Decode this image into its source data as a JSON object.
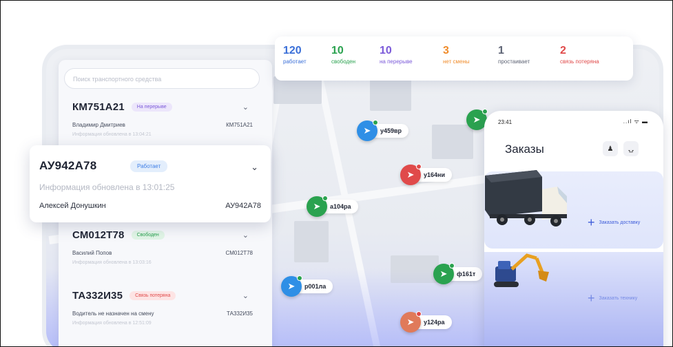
{
  "stats": [
    {
      "value": "120",
      "label": "работает",
      "color": "#3a6fd8"
    },
    {
      "value": "10",
      "label": "свободен",
      "color": "#2aa24f"
    },
    {
      "value": "10",
      "label": "на перерыве",
      "color": "#7b5ad9"
    },
    {
      "value": "3",
      "label": "нет смены",
      "color": "#f08c2b"
    },
    {
      "value": "1",
      "label": "простаивает",
      "color": "#5e6475"
    },
    {
      "value": "2",
      "label": "связь потеряна",
      "color": "#e04a4a"
    }
  ],
  "search": {
    "placeholder": "Поиск транспортного средства"
  },
  "vehicles": [
    {
      "plate": "КМ751А21",
      "status": "На перерыве",
      "driver": "Владимир Дмитриев",
      "plate2": "КМ751А21",
      "updated": "Информация обновлена в 13:04:21"
    },
    {
      "plate": "СМ012Т78",
      "status": "Свободен",
      "driver": "Василий Попов",
      "plate2": "СМ012Т78",
      "updated": "Информация обновлена в 13:03:16"
    },
    {
      "plate": "ТА332И35",
      "status": "Связь потеряна",
      "driver": "Водитель не назначен на смену",
      "plate2": "ТА332И35",
      "updated": "Информация обновлена в 12:51:09"
    }
  ],
  "selected_card": {
    "plate": "АУ942А78",
    "status": "Работает",
    "updated": "Информация обновлена в 13:01:25",
    "driver": "Алексей Донушкин",
    "plate2": "АУ942А78"
  },
  "map_pins": [
    {
      "label": "у459вр",
      "color": "#2f8fe6",
      "status_color": "#2aa24f"
    },
    {
      "label": "у164ни",
      "color": "#e04a4a",
      "status_color": "#e04a4a"
    },
    {
      "label": "а104ра",
      "color": "#2aa24f",
      "status_color": "#2aa24f"
    },
    {
      "label": "р001ла",
      "color": "#2f8fe6",
      "status_color": "#2aa24f"
    },
    {
      "label": "ф161т",
      "color": "#2aa24f",
      "status_color": "#2aa24f"
    },
    {
      "label": "у124ра",
      "color": "#e07a5a",
      "status_color": "#e04a4a"
    },
    {
      "label": "",
      "color": "#2aa24f",
      "status_color": "#2aa24f"
    }
  ],
  "phone": {
    "time": "23:41",
    "signal": "..ıl ᯤ ▬",
    "title": "Заказы",
    "order_delivery": "Заказать доставку",
    "order_technique": "Заказать технику"
  },
  "icons": [
    "user-icon",
    "headphones-icon",
    "chevron-down-icon",
    "navigation-arrow-icon",
    "plus-icon",
    "search-icon"
  ]
}
